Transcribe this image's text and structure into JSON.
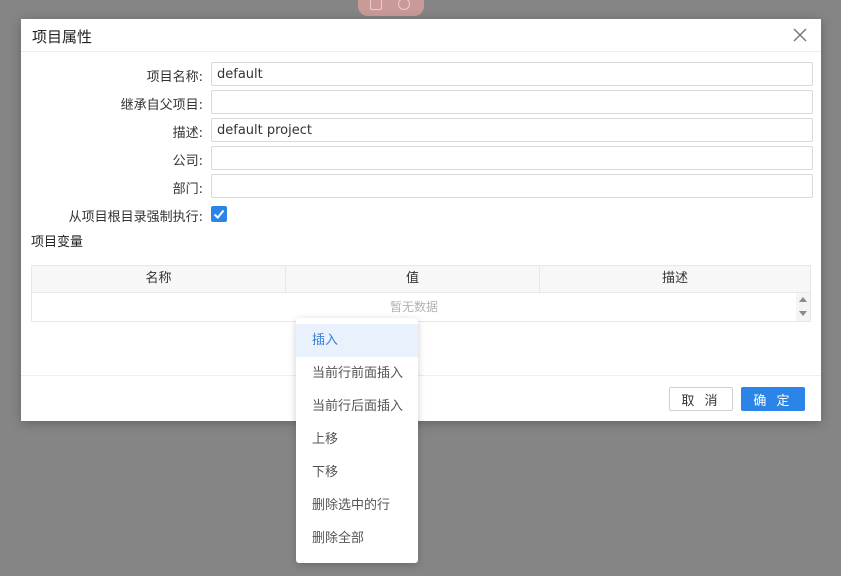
{
  "dialog": {
    "title": "项目属性"
  },
  "form": {
    "fields": [
      {
        "label": "项目名称:",
        "value": "default"
      },
      {
        "label": "继承自父项目:",
        "value": ""
      },
      {
        "label": "描述:",
        "value": "default project"
      },
      {
        "label": "公司:",
        "value": ""
      },
      {
        "label": "部门:",
        "value": ""
      }
    ],
    "force_exec_label": "从项目根目录强制执行:",
    "force_exec_checked": true
  },
  "variables": {
    "section_title": "项目变量",
    "columns": [
      "名称",
      "值",
      "描述"
    ],
    "empty_text": "暂无数据"
  },
  "footer": {
    "cancel_label": "取 消",
    "ok_label": "确 定"
  },
  "context_menu": {
    "items": [
      "插入",
      "当前行前面插入",
      "当前行后面插入",
      "上移",
      "下移",
      "删除选中的行",
      "删除全部"
    ],
    "active_index": 0
  },
  "colors": {
    "primary": "#2b84e8",
    "overlay": "#858585",
    "menu_hover": "#e9f2fc"
  },
  "icons": {
    "close": "close-icon",
    "check": "check-icon",
    "scroll_up": "scroll-up-icon",
    "scroll_down": "scroll-down-icon"
  }
}
